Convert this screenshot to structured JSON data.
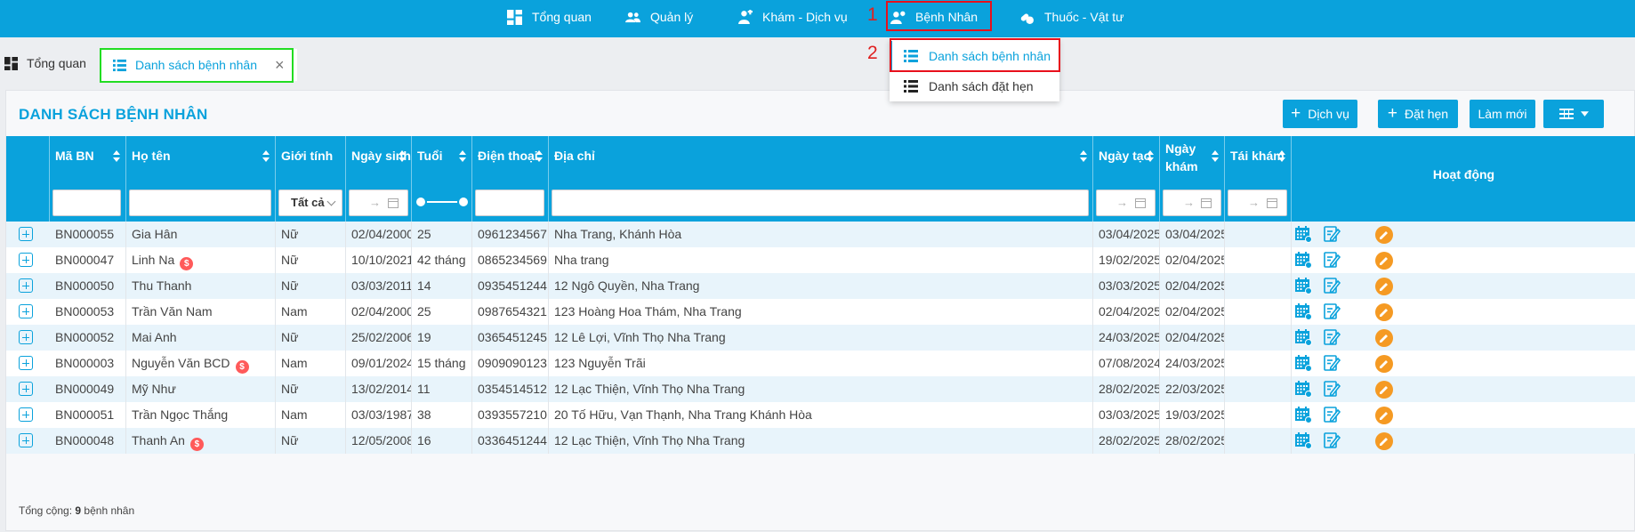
{
  "nav": {
    "items": [
      {
        "label": "Tổng quan",
        "icon": "dashboard-icon"
      },
      {
        "label": "Quản lý",
        "icon": "users-icon"
      },
      {
        "label": "Khám - Dịch vụ",
        "icon": "user-service-icon"
      },
      {
        "label": "Bệnh Nhân",
        "icon": "patient-icon"
      },
      {
        "label": "Thuốc - Vật tư",
        "icon": "pills-icon"
      }
    ]
  },
  "annotations": {
    "step1": "1",
    "step2": "2"
  },
  "tabs": {
    "home_label": "Tổng quan",
    "active_label": "Danh sách bệnh nhân",
    "close_glyph": "×"
  },
  "dropdown": {
    "items": [
      {
        "label": "Danh sách bệnh nhân"
      },
      {
        "label": "Danh sách đặt hẹn"
      }
    ]
  },
  "panel": {
    "title": "DANH SÁCH BỆNH NHÂN",
    "buttons": {
      "service": "Dịch vụ",
      "appointment": "Đặt hẹn",
      "refresh": "Làm mới"
    },
    "plus": "+"
  },
  "table": {
    "headers": {
      "code": "Mã BN",
      "name": "Họ tên",
      "gender": "Giới tính",
      "dob": "Ngày sinh",
      "age": "Tuổi",
      "phone": "Điện thoại",
      "address": "Địa chỉ",
      "created": "Ngày tạo",
      "visit_line1": "Ngày",
      "visit_line2": "khám",
      "revisit": "Tái khám",
      "actions": "Hoạt động"
    },
    "filters": {
      "gender_selected": "Tất cả",
      "date_arrow": "→"
    },
    "rows": [
      {
        "code": "BN000055",
        "name": "Gia Hân",
        "coin": false,
        "gender": "Nữ",
        "dob": "02/04/2000",
        "age": "25",
        "phone": "0961234567",
        "address": "Nha Trang, Khánh Hòa",
        "created": "03/04/2025",
        "visit": "03/04/2025",
        "revisit": ""
      },
      {
        "code": "BN000047",
        "name": "Linh Na",
        "coin": true,
        "gender": "Nữ",
        "dob": "10/10/2021",
        "age": "42 tháng",
        "phone": "0865234569",
        "address": "Nha trang",
        "created": "19/02/2025",
        "visit": "02/04/2025",
        "revisit": ""
      },
      {
        "code": "BN000050",
        "name": "Thu Thanh",
        "coin": false,
        "gender": "Nữ",
        "dob": "03/03/2011",
        "age": "14",
        "phone": "0935451244",
        "address": "12 Ngô Quyền, Nha Trang",
        "created": "03/03/2025",
        "visit": "02/04/2025",
        "revisit": ""
      },
      {
        "code": "BN000053",
        "name": "Trần Văn Nam",
        "coin": false,
        "gender": "Nam",
        "dob": "02/04/2000",
        "age": "25",
        "phone": "0987654321",
        "address": "123 Hoàng Hoa Thám, Nha Trang",
        "created": "02/04/2025",
        "visit": "02/04/2025",
        "revisit": ""
      },
      {
        "code": "BN000052",
        "name": "Mai Anh",
        "coin": false,
        "gender": "Nữ",
        "dob": "25/02/2006",
        "age": "19",
        "phone": "0365451245",
        "address": "12 Lê Lợi, Vĩnh Thọ Nha Trang",
        "created": "24/03/2025",
        "visit": "02/04/2025",
        "revisit": ""
      },
      {
        "code": "BN000003",
        "name": "Nguyễn Văn BCD",
        "coin": true,
        "gender": "Nam",
        "dob": "09/01/2024",
        "age": "15 tháng",
        "phone": "0909090123",
        "address": "123 Nguyễn Trãi",
        "created": "07/08/2024",
        "visit": "24/03/2025",
        "revisit": ""
      },
      {
        "code": "BN000049",
        "name": "Mỹ Như",
        "coin": false,
        "gender": "Nữ",
        "dob": "13/02/2014",
        "age": "11",
        "phone": "0354514512",
        "address": "12 Lạc Thiện, Vĩnh Thọ Nha Trang",
        "created": "28/02/2025",
        "visit": "22/03/2025",
        "revisit": ""
      },
      {
        "code": "BN000051",
        "name": "Trần Ngọc Thắng",
        "coin": false,
        "gender": "Nam",
        "dob": "03/03/1987",
        "age": "38",
        "phone": "0393557210",
        "address": "20 Tố Hữu, Vạn Thạnh, Nha Trang Khánh Hòa",
        "created": "03/03/2025",
        "visit": "19/03/2025",
        "revisit": ""
      },
      {
        "code": "BN000048",
        "name": "Thanh An",
        "coin": true,
        "gender": "Nữ",
        "dob": "12/05/2008",
        "age": "16",
        "phone": "0336451244",
        "address": "12 Lạc Thiện, Vĩnh Thọ Nha Trang",
        "created": "28/02/2025",
        "visit": "28/02/2025",
        "revisit": ""
      }
    ],
    "coin_glyph": "$"
  },
  "footer": {
    "prefix": "Tổng cộng:",
    "count": "9",
    "suffix": "bệnh nhân"
  },
  "colors": {
    "primary": "#0aa2dc",
    "edit": "#f59a23",
    "coin": "#ff5a5a",
    "highlight_red": "#e8101c",
    "highlight_green": "#22dd22"
  }
}
